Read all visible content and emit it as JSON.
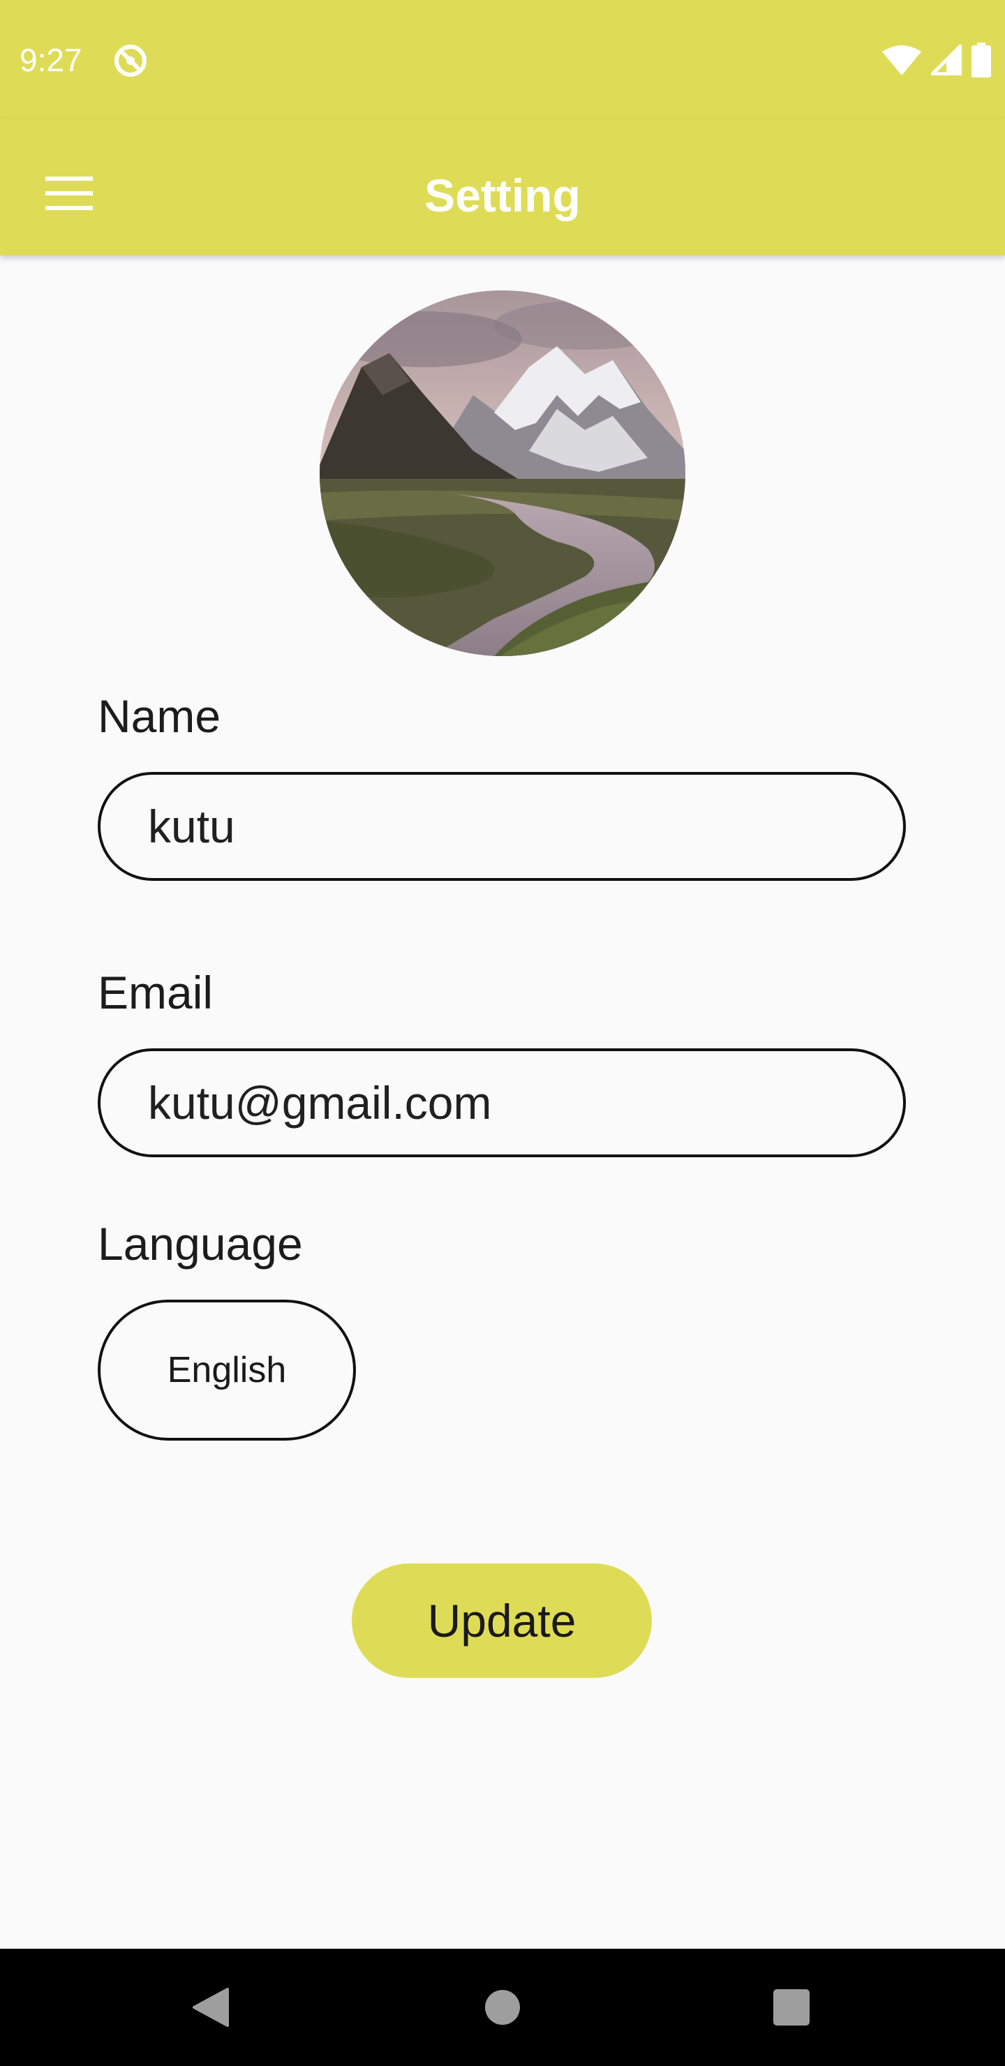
{
  "status_bar": {
    "time": "9:27",
    "icons": [
      "sync-icon",
      "wifi-icon",
      "signal-icon",
      "battery-icon"
    ]
  },
  "app_bar": {
    "title": "Setting",
    "menu_icon": "hamburger-menu-icon"
  },
  "profile": {
    "avatar_description": "mountain-landscape-photo"
  },
  "form": {
    "name_label": "Name",
    "name_value": "kutu",
    "email_label": "Email",
    "email_value": "kutu@gmail.com",
    "language_label": "Language",
    "language_value": "English",
    "update_label": "Update"
  },
  "nav_bar": {
    "icons": [
      "back-icon",
      "home-icon",
      "recents-icon"
    ]
  },
  "colors": {
    "accent": "#dedc56",
    "background": "#fafafa",
    "nav_bar": "#000000"
  }
}
